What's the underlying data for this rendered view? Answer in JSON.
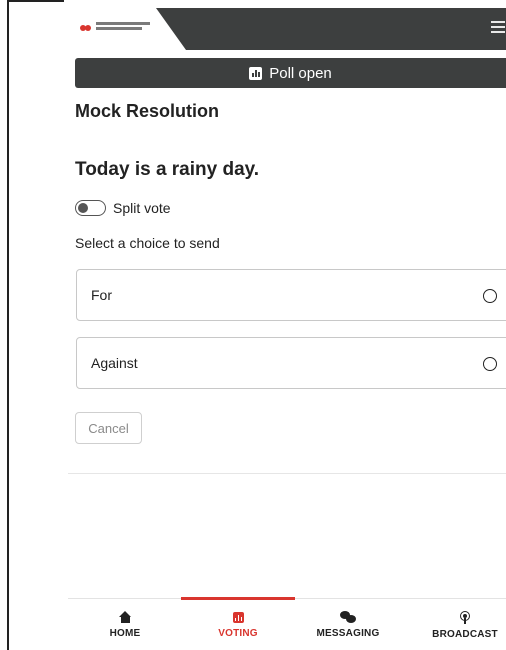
{
  "banner": {
    "icon": "bar-chart-icon",
    "label": "Poll open"
  },
  "resolution": {
    "title": "Mock Resolution",
    "question": "Today is a rainy day."
  },
  "split_vote": {
    "label": "Split vote",
    "enabled": false
  },
  "choices": {
    "prompt": "Select a choice to send",
    "options": [
      {
        "label": "For",
        "selected": false
      },
      {
        "label": "Against",
        "selected": false
      }
    ]
  },
  "actions": {
    "cancel_label": "Cancel"
  },
  "bottom_nav": {
    "items": [
      {
        "label": "HOME",
        "icon": "home-icon",
        "active": false
      },
      {
        "label": "VOTING",
        "icon": "voting-icon",
        "active": true
      },
      {
        "label": "MESSAGING",
        "icon": "messaging-icon",
        "active": false
      },
      {
        "label": "BROADCAST",
        "icon": "broadcast-icon",
        "active": false
      }
    ]
  },
  "colors": {
    "topbar": "#3d3f3f",
    "accent": "#d9352e",
    "text": "#222222"
  }
}
